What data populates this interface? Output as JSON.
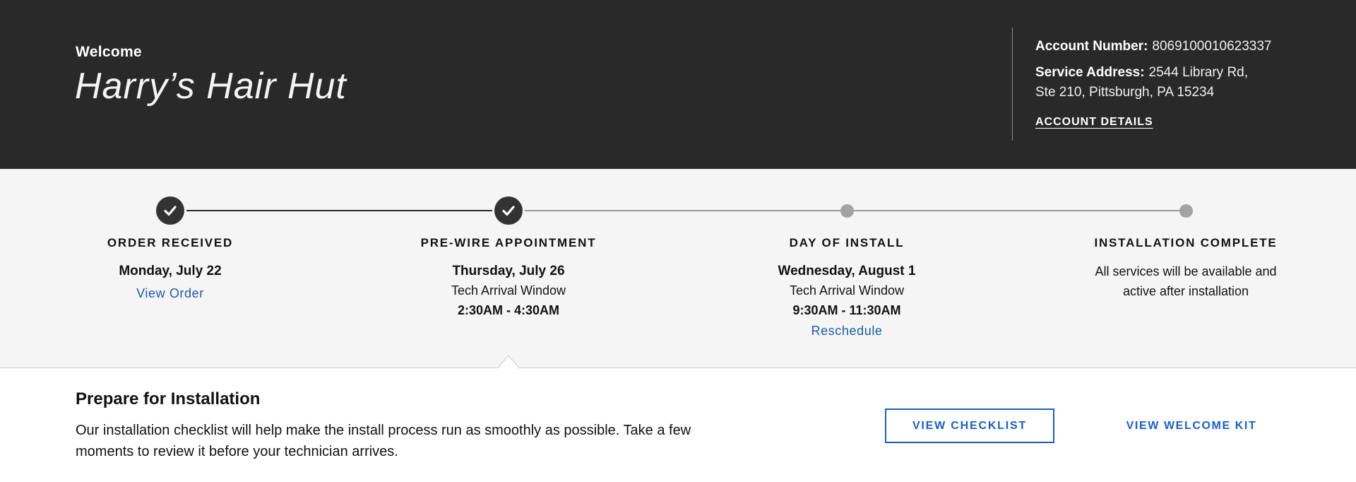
{
  "header": {
    "welcome": "Welcome",
    "business_name": "Harry’s Hair Hut",
    "account_number_label": "Account Number:",
    "account_number": "8069100010623337",
    "service_address_label": "Service Address:",
    "service_address_line1": "2544 Library Rd,",
    "service_address_line2": "Ste 210, Pittsburgh, PA 15234",
    "account_details_link": "ACCOUNT DETAILS"
  },
  "progress": {
    "colors": {
      "done": "#333333",
      "todo": "#a3a3a3",
      "link": "#1d5aa6"
    },
    "steps": [
      {
        "title": "ORDER RECEIVED",
        "date": "Monday, July 22",
        "link": "View Order",
        "status": "complete"
      },
      {
        "title": "PRE-WIRE APPOINTMENT",
        "date": "Thursday, July 26",
        "window_label": "Tech Arrival Window",
        "window": "2:30AM - 4:30AM",
        "status": "complete"
      },
      {
        "title": "DAY OF INSTALL",
        "date": "Wednesday, August 1",
        "window_label": "Tech Arrival Window",
        "window": "9:30AM - 11:30AM",
        "link": "Reschedule",
        "status": "upcoming"
      },
      {
        "title": "INSTALLATION COMPLETE",
        "description_line1": "All services will be available and",
        "description_line2": "active after installation",
        "status": "upcoming"
      }
    ]
  },
  "prepare": {
    "title": "Prepare for Installation",
    "body_line1": "Our installation checklist will help make the install process run as smoothly as possible. Take a few",
    "body_line2": "moments to review it before your technician arrives.",
    "checklist_button": "VIEW CHECKLIST",
    "welcome_kit_button": "VIEW WELCOME KIT"
  }
}
